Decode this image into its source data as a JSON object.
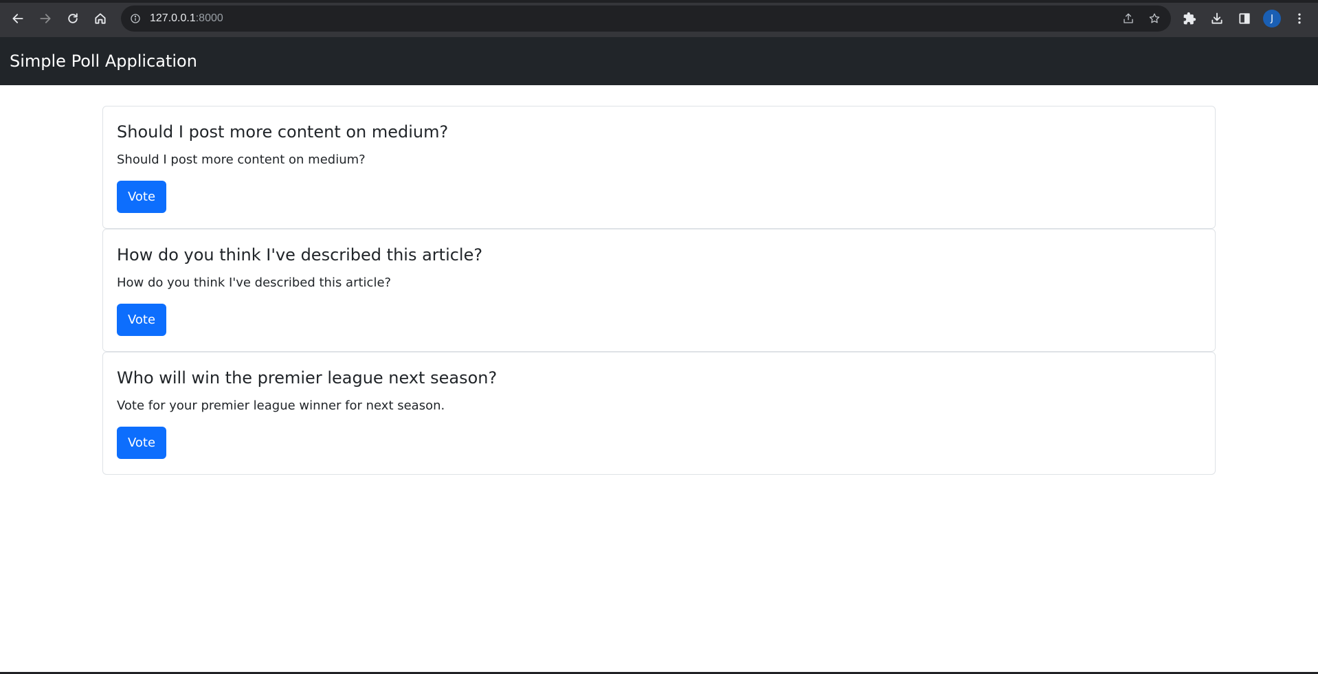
{
  "browser": {
    "url_host": "127.0.0.1",
    "url_port": ":8000",
    "avatar_initial": "J",
    "icons": [
      "back-icon",
      "forward-icon",
      "reload-icon",
      "home-icon",
      "info-icon",
      "share-icon",
      "star-icon",
      "extensions-icon",
      "download-icon",
      "side-panel-icon",
      "menu-icon"
    ]
  },
  "navbar": {
    "brand": "Simple Poll Application"
  },
  "polls": [
    {
      "title": "Should I post more content on medium?",
      "description": "Should I post more content on medium?",
      "button_label": "Vote"
    },
    {
      "title": "How do you think I've described this article?",
      "description": "How do you think I've described this article?",
      "button_label": "Vote"
    },
    {
      "title": "Who will win the premier league next season?",
      "description": "Vote for your premier league winner for next season.",
      "button_label": "Vote"
    }
  ],
  "colors": {
    "navbar_bg": "#212529",
    "button_primary": "#0d6efd",
    "browser_bg": "#35363a",
    "omnibox_bg": "#202124"
  }
}
